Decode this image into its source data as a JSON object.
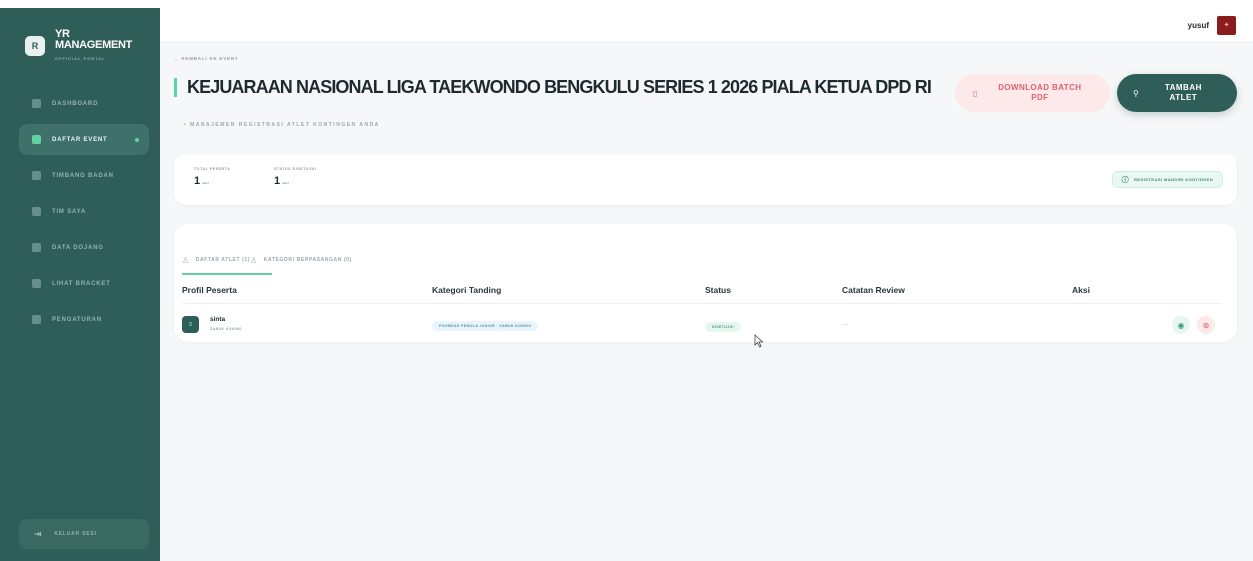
{
  "brand": {
    "line1": "YR",
    "line2": "MANAGEMENT",
    "tagline": "OFFICIAL PORTAL",
    "logo_text": "R"
  },
  "sidebar": {
    "items": [
      {
        "label": "DASHBOARD",
        "icon": "home-icon"
      },
      {
        "label": "DAFTAR EVENT",
        "icon": "calendar-icon"
      },
      {
        "label": "TIMBANG BADAN",
        "icon": "scale-icon"
      },
      {
        "label": "TIM SAYA",
        "icon": "users-icon"
      },
      {
        "label": "DATA DOJANG",
        "icon": "building-icon"
      },
      {
        "label": "LIHAT BRACKET",
        "icon": "bracket-icon"
      },
      {
        "label": "PENGATURAN",
        "icon": "gear-icon"
      }
    ],
    "logout": "KELUAR SESI"
  },
  "topbar": {
    "username": "yusuf"
  },
  "header": {
    "back_label": "KEMBALI KE EVENT",
    "title": "KEJUARAAN NASIONAL LIGA TAEKWONDO BENGKULU SERIES 1 2026 PIALA KETUA DPD RI",
    "subtitle": "• MANAJEMEN REGISTRASI ATLET KONTINGEN ANDA",
    "download_label": "DOWNLOAD BATCH PDF",
    "add_label": "TAMBAH ATLET"
  },
  "stats": {
    "total_label": "TOTAL PESERTA",
    "total_value": "1",
    "total_unit": "Atlet",
    "approved_label": "STATUS DISETUJUI",
    "approved_value": "1",
    "approved_unit": "Atlet",
    "register_badge": "REGISTRASI MANDIRI KONTINGEN"
  },
  "tabs": [
    {
      "label": "DAFTAR ATLET (1)"
    },
    {
      "label": "KATEGORI BERPASANGAN (0)"
    }
  ],
  "table": {
    "headers": [
      "Profil Peserta",
      "Kategori Tanding",
      "Status",
      "Catatan Review",
      "Aksi"
    ],
    "rows": [
      {
        "initial": "S",
        "name": "sinta",
        "belt": "SABUK KUNING",
        "category": "POOMSAE PEMULA JUNIOR · SABUK KUNING",
        "status": "DISETUJUI",
        "review": "—"
      }
    ]
  },
  "colors": {
    "sidebar": "#2f5d57",
    "accent": "#63d1a6",
    "danger": "#e0626d"
  }
}
